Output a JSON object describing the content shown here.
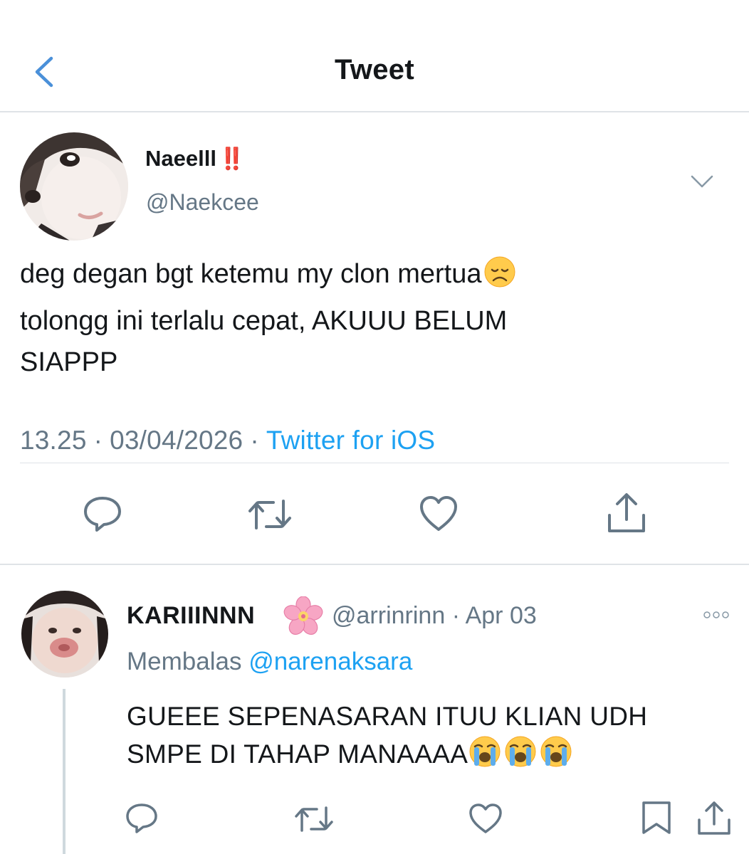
{
  "header": {
    "title": "Tweet",
    "back_icon": "chevron-left-icon"
  },
  "tweet": {
    "author_name": "Naeelll",
    "author_name_emoji": "‼️",
    "author_handle": "@Naekcee",
    "text_line1": "deg degan bgt ketemu my clon mertua",
    "text_line1_emoji": "😞",
    "text_line2": "tolongg ini terlalu cepat, AKUUU BELUM",
    "text_line3": "SIAPPP",
    "time": "13.25",
    "date": "03/04/2026",
    "separator": "·",
    "source": "Twitter for iOS",
    "actions": [
      "reply-icon",
      "retweet-icon",
      "like-icon",
      "share-icon"
    ]
  },
  "reply": {
    "author_name": "KARIIINNN",
    "author_emoji": "🌸",
    "author_handle": "@arrinrinn",
    "separator": "·",
    "date": "Apr 03",
    "replying_prefix": "Membalas",
    "replying_to": "@narenaksara",
    "text_line1": "GUEEE SEPENASARAN ITUU KLIAN UDH",
    "text_line2": "SMPE DI TAHAP MANAAAA",
    "text_emojis": "😭😭😭",
    "actions": [
      "reply-icon",
      "retweet-icon",
      "like-icon",
      "bookmark-icon",
      "share-icon"
    ]
  },
  "colors": {
    "accent": "#1da1f2",
    "secondary_text": "#657786",
    "primary_text": "#14171a",
    "divider": "#dfe3e7"
  }
}
